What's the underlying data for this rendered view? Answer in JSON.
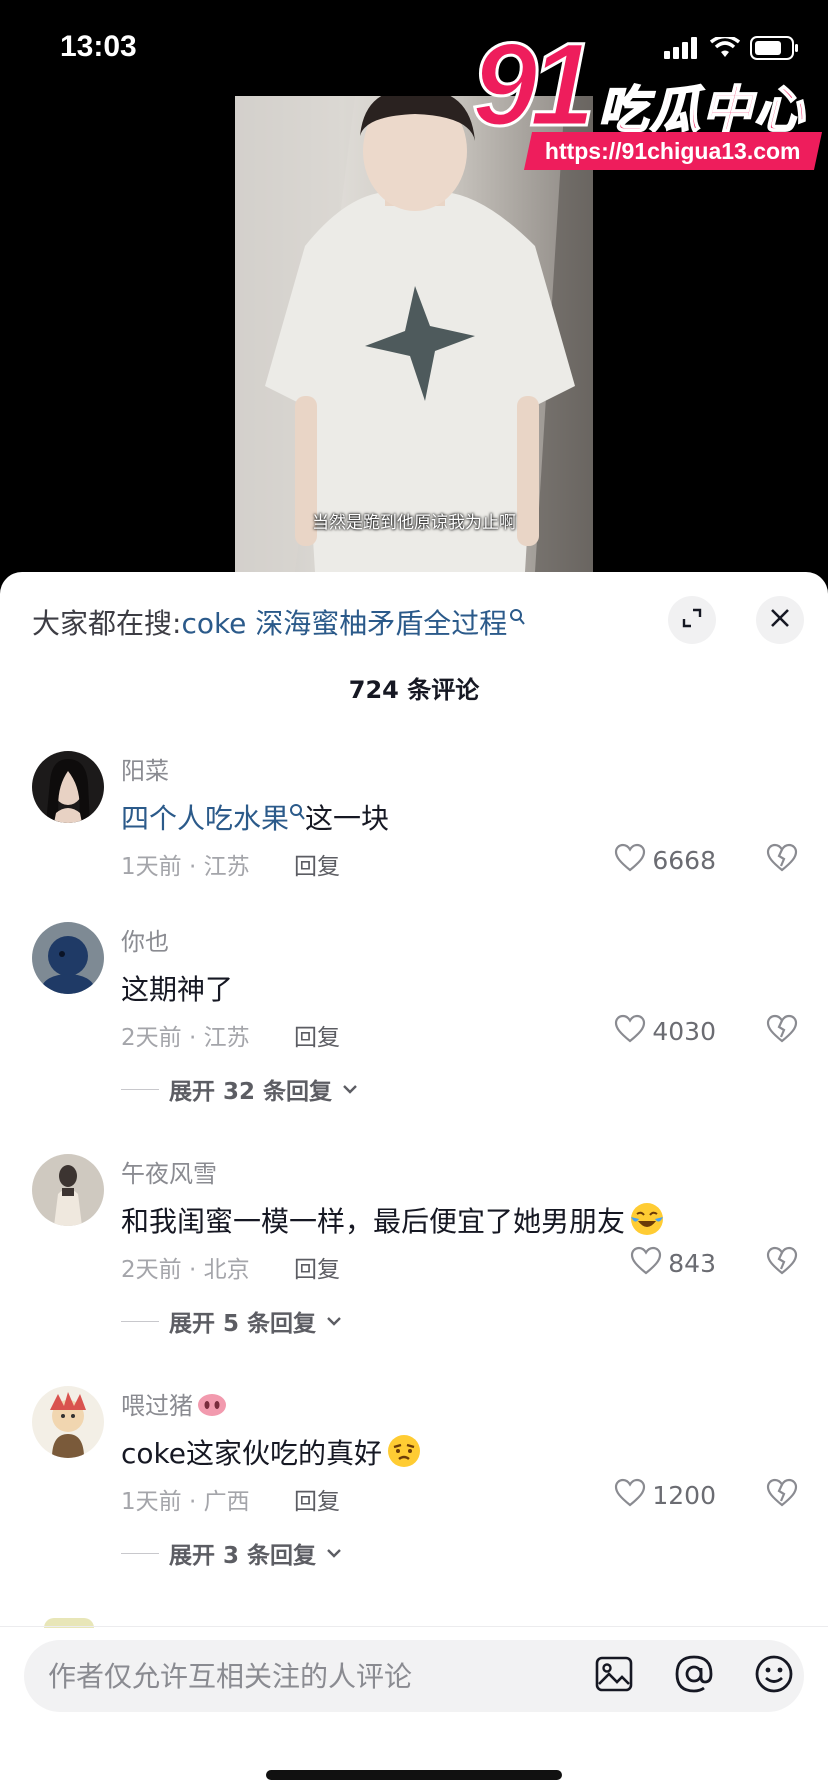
{
  "status_bar": {
    "time": "13:03"
  },
  "watermark": {
    "number": "91",
    "name": "吃瓜中心",
    "url": "https://91chigua13.com"
  },
  "video": {
    "subtitle": "当然是跪到他原谅我为止啊"
  },
  "sheet": {
    "search_prefix": "大家都在搜:",
    "search_keyword": "coke 深海蜜柚矛盾全过程",
    "comment_count": "724 条评论"
  },
  "comments": [
    {
      "name": "阳菜",
      "text_link": "四个人吃水果",
      "text": "这一块",
      "time_location": "1天前 · 江苏",
      "reply_label": "回复",
      "likes": "6668"
    },
    {
      "name": "你也",
      "text": "这期神了",
      "time_location": "2天前 · 江苏",
      "reply_label": "回复",
      "likes": "4030",
      "expand_label": "展开 32 条回复"
    },
    {
      "name": "午夜风雪",
      "text": "和我闺蜜一模一样，最后便宜了她男朋友",
      "time_location": "2天前 · 北京",
      "reply_label": "回复",
      "likes": "843",
      "expand_label": "展开 5 条回复"
    },
    {
      "name": "喂过猪",
      "text": "coke这家伙吃的真好",
      "time_location": "1天前 · 广西",
      "reply_label": "回复",
      "likes": "1200",
      "expand_label": "展开 3 条回复"
    }
  ],
  "input": {
    "placeholder": "作者仅允许互相关注的人评论"
  },
  "colors": {
    "link": "#2b5a8a",
    "watermark": "#ee1d5c",
    "sheet_bg": "#ffffff"
  }
}
